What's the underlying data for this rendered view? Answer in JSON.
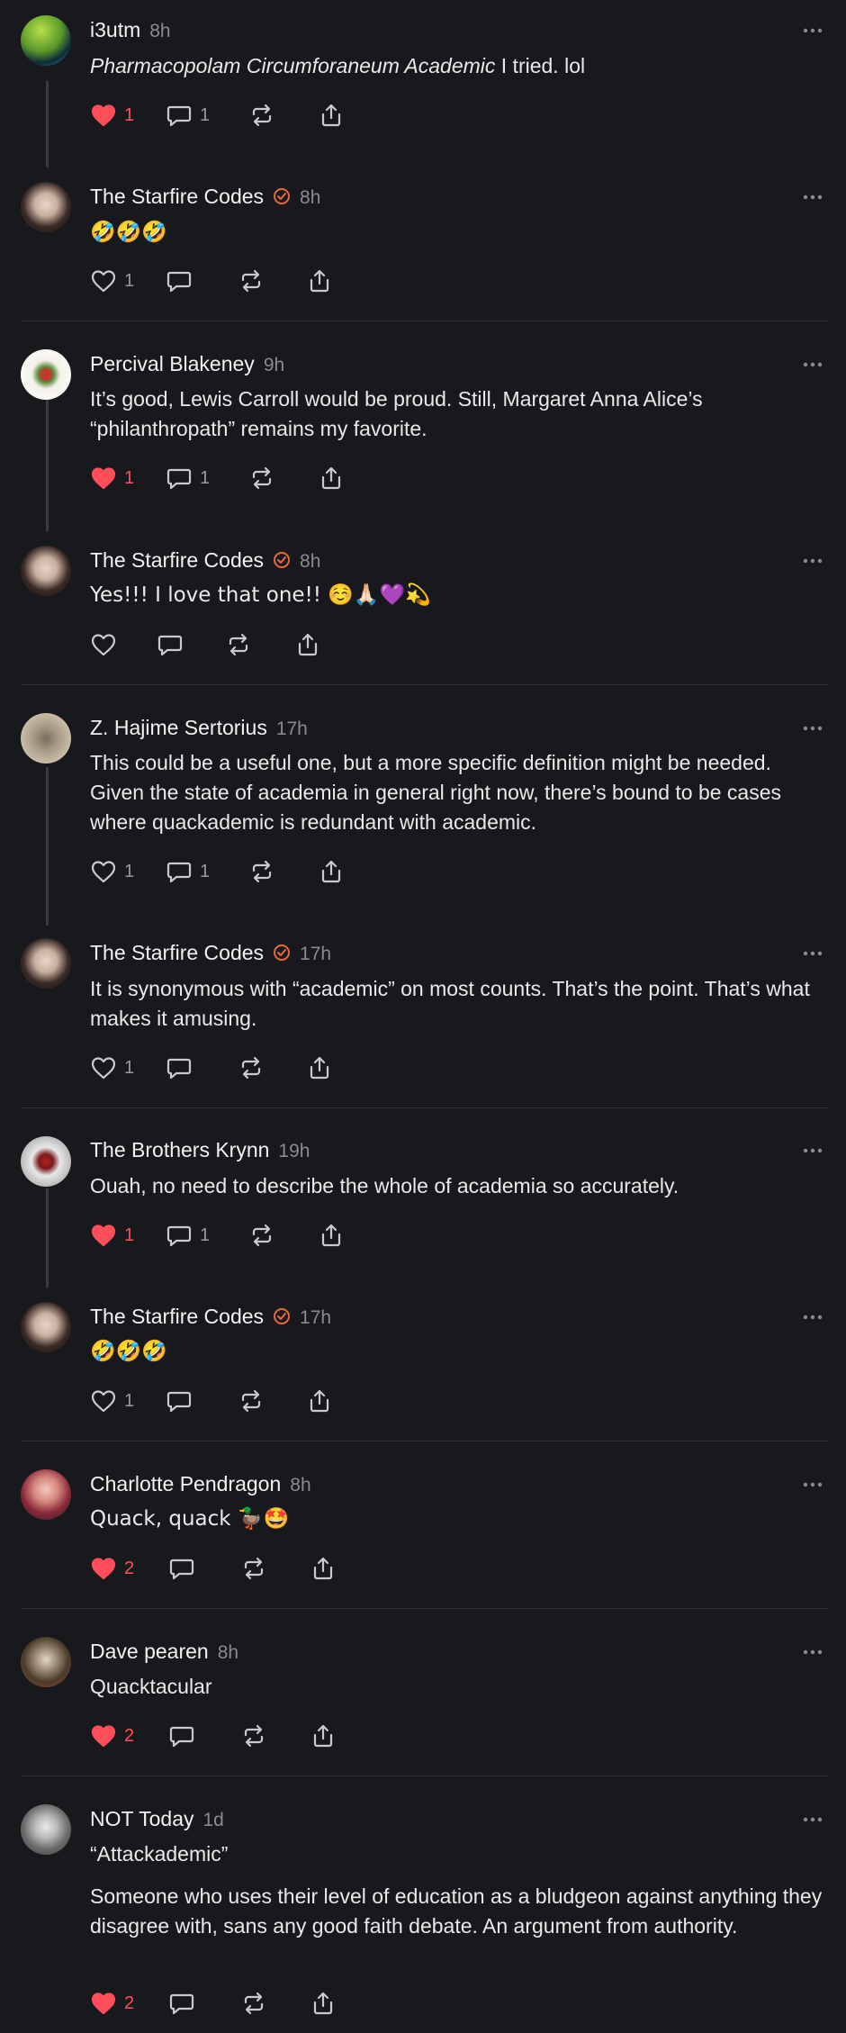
{
  "colors": {
    "background": "#18191c",
    "like_red": "#ff4d5a",
    "badge_orange": "#e8693b",
    "muted": "#8a8b8f"
  },
  "posts": [
    {
      "author": "i3utm",
      "time": "8h",
      "verified": false,
      "italic": "Pharmacopolam Circumforaneum Academic",
      "text": "I tried. lol",
      "likes": "1",
      "liked": true,
      "replies": "1"
    },
    {
      "author": "The Starfire Codes",
      "time": "8h",
      "verified": true,
      "text": "🤣🤣🤣",
      "likes": "1",
      "liked": false,
      "replies": ""
    },
    {
      "author": "Percival Blakeney",
      "time": "9h",
      "verified": false,
      "text": "It’s good, Lewis Carroll would be proud. Still, Margaret Anna Alice’s “philanthropath” remains my favorite.",
      "likes": "1",
      "liked": true,
      "replies": "1"
    },
    {
      "author": "The Starfire Codes",
      "time": "8h",
      "verified": true,
      "text": "Yes!!! I love that one!! ☺️🙏🏻💜💫",
      "likes": "",
      "liked": false,
      "replies": ""
    },
    {
      "author": "Z. Hajime Sertorius",
      "time": "17h",
      "verified": false,
      "text": "This could be a useful one, but a more specific definition might be needed. Given the state of academia in general right now, there’s bound to be cases where quackademic is redundant with academic.",
      "likes": "1",
      "liked": false,
      "replies": "1"
    },
    {
      "author": "The Starfire Codes",
      "time": "17h",
      "verified": true,
      "text": "It is synonymous with “academic” on most counts. That’s the point. That’s what makes it amusing.",
      "likes": "1",
      "liked": false,
      "replies": ""
    },
    {
      "author": "The Brothers Krynn",
      "time": "19h",
      "verified": false,
      "text": "Ouah, no need to describe the whole of academia so accurately.",
      "likes": "1",
      "liked": true,
      "replies": "1"
    },
    {
      "author": "The Starfire Codes",
      "time": "17h",
      "verified": true,
      "text": "🤣🤣🤣",
      "likes": "1",
      "liked": false,
      "replies": ""
    },
    {
      "author": "Charlotte Pendragon",
      "time": "8h",
      "verified": false,
      "text": "Quack, quack 🦆🤩",
      "likes": "2",
      "liked": true,
      "replies": ""
    },
    {
      "author": "Dave pearen",
      "time": "8h",
      "verified": false,
      "text": "Quacktacular",
      "likes": "2",
      "liked": true,
      "replies": ""
    },
    {
      "author": "NOT Today",
      "time": "1d",
      "verified": false,
      "text": "“Attackademic”",
      "text2": "Someone who uses their level of education as a bludgeon against anything they disagree with, sans any good faith debate. An argument from authority.",
      "likes": "2",
      "liked": true,
      "replies": ""
    }
  ]
}
